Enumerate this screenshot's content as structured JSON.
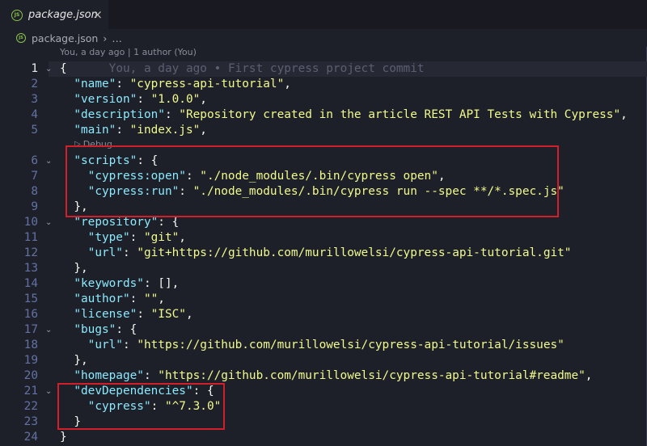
{
  "tab": {
    "icon_text": "JS",
    "title": "package.json",
    "close": "×"
  },
  "breadcrumb": {
    "file": "package.json",
    "separator": "›",
    "more": "…"
  },
  "codelens": {
    "blame": "You, a day ago | 1 author (You)",
    "debug": "Debug"
  },
  "inline_blame": "You, a day ago • First cypress project commit",
  "lines": [
    {
      "n": "1",
      "fold": "⌄",
      "tokens": [
        {
          "t": "{",
          "c": "p"
        }
      ]
    },
    {
      "n": "2",
      "fold": "",
      "tokens": [
        {
          "t": "  ",
          "c": "p"
        },
        {
          "t": "\"name\"",
          "c": "k"
        },
        {
          "t": ": ",
          "c": "p"
        },
        {
          "t": "\"cypress-api-tutorial\"",
          "c": "s"
        },
        {
          "t": ",",
          "c": "p"
        }
      ]
    },
    {
      "n": "3",
      "fold": "",
      "tokens": [
        {
          "t": "  ",
          "c": "p"
        },
        {
          "t": "\"version\"",
          "c": "k"
        },
        {
          "t": ": ",
          "c": "p"
        },
        {
          "t": "\"1.0.0\"",
          "c": "s"
        },
        {
          "t": ",",
          "c": "p"
        }
      ]
    },
    {
      "n": "4",
      "fold": "",
      "tokens": [
        {
          "t": "  ",
          "c": "p"
        },
        {
          "t": "\"description\"",
          "c": "k"
        },
        {
          "t": ": ",
          "c": "p"
        },
        {
          "t": "\"Repository created in the article REST API Tests with Cypress\"",
          "c": "s"
        },
        {
          "t": ",",
          "c": "p"
        }
      ]
    },
    {
      "n": "5",
      "fold": "",
      "tokens": [
        {
          "t": "  ",
          "c": "p"
        },
        {
          "t": "\"main\"",
          "c": "k"
        },
        {
          "t": ": ",
          "c": "p"
        },
        {
          "t": "\"index.js\"",
          "c": "s"
        },
        {
          "t": ",",
          "c": "p"
        }
      ]
    },
    {
      "n": "6",
      "fold": "⌄",
      "tokens": [
        {
          "t": "  ",
          "c": "p"
        },
        {
          "t": "\"scripts\"",
          "c": "k"
        },
        {
          "t": ": {",
          "c": "p"
        }
      ]
    },
    {
      "n": "7",
      "fold": "",
      "tokens": [
        {
          "t": "    ",
          "c": "p"
        },
        {
          "t": "\"cypress:open\"",
          "c": "k"
        },
        {
          "t": ": ",
          "c": "p"
        },
        {
          "t": "\"./node_modules/.bin/cypress open\"",
          "c": "s"
        },
        {
          "t": ",",
          "c": "p"
        }
      ]
    },
    {
      "n": "8",
      "fold": "",
      "tokens": [
        {
          "t": "    ",
          "c": "p"
        },
        {
          "t": "\"cypress:run\"",
          "c": "k"
        },
        {
          "t": ": ",
          "c": "p"
        },
        {
          "t": "\"./node_modules/.bin/cypress run --spec **/*.spec.js\"",
          "c": "s"
        }
      ]
    },
    {
      "n": "9",
      "fold": "",
      "tokens": [
        {
          "t": "  },",
          "c": "p"
        }
      ]
    },
    {
      "n": "10",
      "fold": "⌄",
      "tokens": [
        {
          "t": "  ",
          "c": "p"
        },
        {
          "t": "\"repository\"",
          "c": "k"
        },
        {
          "t": ": {",
          "c": "p"
        }
      ]
    },
    {
      "n": "11",
      "fold": "",
      "tokens": [
        {
          "t": "    ",
          "c": "p"
        },
        {
          "t": "\"type\"",
          "c": "k"
        },
        {
          "t": ": ",
          "c": "p"
        },
        {
          "t": "\"git\"",
          "c": "s"
        },
        {
          "t": ",",
          "c": "p"
        }
      ]
    },
    {
      "n": "12",
      "fold": "",
      "tokens": [
        {
          "t": "    ",
          "c": "p"
        },
        {
          "t": "\"url\"",
          "c": "k"
        },
        {
          "t": ": ",
          "c": "p"
        },
        {
          "t": "\"git+https://github.com/murillowelsi/cypress-api-tutorial.git\"",
          "c": "s"
        }
      ]
    },
    {
      "n": "13",
      "fold": "",
      "tokens": [
        {
          "t": "  },",
          "c": "p"
        }
      ]
    },
    {
      "n": "14",
      "fold": "",
      "tokens": [
        {
          "t": "  ",
          "c": "p"
        },
        {
          "t": "\"keywords\"",
          "c": "k"
        },
        {
          "t": ": [],",
          "c": "p"
        }
      ]
    },
    {
      "n": "15",
      "fold": "",
      "tokens": [
        {
          "t": "  ",
          "c": "p"
        },
        {
          "t": "\"author\"",
          "c": "k"
        },
        {
          "t": ": ",
          "c": "p"
        },
        {
          "t": "\"\"",
          "c": "s"
        },
        {
          "t": ",",
          "c": "p"
        }
      ]
    },
    {
      "n": "16",
      "fold": "",
      "tokens": [
        {
          "t": "  ",
          "c": "p"
        },
        {
          "t": "\"license\"",
          "c": "k"
        },
        {
          "t": ": ",
          "c": "p"
        },
        {
          "t": "\"ISC\"",
          "c": "s"
        },
        {
          "t": ",",
          "c": "p"
        }
      ]
    },
    {
      "n": "17",
      "fold": "⌄",
      "tokens": [
        {
          "t": "  ",
          "c": "p"
        },
        {
          "t": "\"bugs\"",
          "c": "k"
        },
        {
          "t": ": {",
          "c": "p"
        }
      ]
    },
    {
      "n": "18",
      "fold": "",
      "tokens": [
        {
          "t": "    ",
          "c": "p"
        },
        {
          "t": "\"url\"",
          "c": "k"
        },
        {
          "t": ": ",
          "c": "p"
        },
        {
          "t": "\"https://github.com/murillowelsi/cypress-api-tutorial/issues\"",
          "c": "s"
        }
      ]
    },
    {
      "n": "19",
      "fold": "",
      "tokens": [
        {
          "t": "  },",
          "c": "p"
        }
      ]
    },
    {
      "n": "20",
      "fold": "",
      "tokens": [
        {
          "t": "  ",
          "c": "p"
        },
        {
          "t": "\"homepage\"",
          "c": "k"
        },
        {
          "t": ": ",
          "c": "p"
        },
        {
          "t": "\"https://github.com/murillowelsi/cypress-api-tutorial#readme\"",
          "c": "s"
        },
        {
          "t": ",",
          "c": "p"
        }
      ]
    },
    {
      "n": "21",
      "fold": "⌄",
      "tokens": [
        {
          "t": "  ",
          "c": "p"
        },
        {
          "t": "\"devDependencies\"",
          "c": "k"
        },
        {
          "t": ": {",
          "c": "p"
        }
      ]
    },
    {
      "n": "22",
      "fold": "",
      "tokens": [
        {
          "t": "    ",
          "c": "p"
        },
        {
          "t": "\"cypress\"",
          "c": "k"
        },
        {
          "t": ": ",
          "c": "p"
        },
        {
          "t": "\"^7.3.0\"",
          "c": "s"
        }
      ]
    },
    {
      "n": "23",
      "fold": "",
      "tokens": [
        {
          "t": "  }",
          "c": "p"
        }
      ]
    },
    {
      "n": "24",
      "fold": "",
      "tokens": [
        {
          "t": "}",
          "c": "p"
        }
      ]
    }
  ],
  "colors": {
    "background": "#1e2029",
    "key": "#8be9fd",
    "string": "#f1fa8c",
    "annotation": "#d21f2a"
  }
}
